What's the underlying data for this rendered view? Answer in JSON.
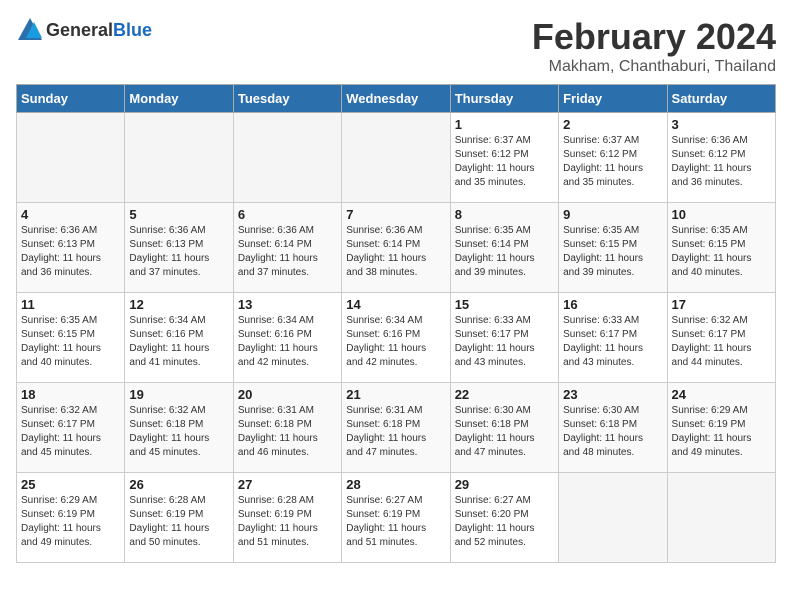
{
  "header": {
    "logo_general": "General",
    "logo_blue": "Blue",
    "title": "February 2024",
    "subtitle": "Makham, Chanthaburi, Thailand"
  },
  "days_of_week": [
    "Sunday",
    "Monday",
    "Tuesday",
    "Wednesday",
    "Thursday",
    "Friday",
    "Saturday"
  ],
  "weeks": [
    [
      {
        "day": "",
        "info": ""
      },
      {
        "day": "",
        "info": ""
      },
      {
        "day": "",
        "info": ""
      },
      {
        "day": "",
        "info": ""
      },
      {
        "day": "1",
        "info": "Sunrise: 6:37 AM\nSunset: 6:12 PM\nDaylight: 11 hours\nand 35 minutes."
      },
      {
        "day": "2",
        "info": "Sunrise: 6:37 AM\nSunset: 6:12 PM\nDaylight: 11 hours\nand 35 minutes."
      },
      {
        "day": "3",
        "info": "Sunrise: 6:36 AM\nSunset: 6:12 PM\nDaylight: 11 hours\nand 36 minutes."
      }
    ],
    [
      {
        "day": "4",
        "info": "Sunrise: 6:36 AM\nSunset: 6:13 PM\nDaylight: 11 hours\nand 36 minutes."
      },
      {
        "day": "5",
        "info": "Sunrise: 6:36 AM\nSunset: 6:13 PM\nDaylight: 11 hours\nand 37 minutes."
      },
      {
        "day": "6",
        "info": "Sunrise: 6:36 AM\nSunset: 6:14 PM\nDaylight: 11 hours\nand 37 minutes."
      },
      {
        "day": "7",
        "info": "Sunrise: 6:36 AM\nSunset: 6:14 PM\nDaylight: 11 hours\nand 38 minutes."
      },
      {
        "day": "8",
        "info": "Sunrise: 6:35 AM\nSunset: 6:14 PM\nDaylight: 11 hours\nand 39 minutes."
      },
      {
        "day": "9",
        "info": "Sunrise: 6:35 AM\nSunset: 6:15 PM\nDaylight: 11 hours\nand 39 minutes."
      },
      {
        "day": "10",
        "info": "Sunrise: 6:35 AM\nSunset: 6:15 PM\nDaylight: 11 hours\nand 40 minutes."
      }
    ],
    [
      {
        "day": "11",
        "info": "Sunrise: 6:35 AM\nSunset: 6:15 PM\nDaylight: 11 hours\nand 40 minutes."
      },
      {
        "day": "12",
        "info": "Sunrise: 6:34 AM\nSunset: 6:16 PM\nDaylight: 11 hours\nand 41 minutes."
      },
      {
        "day": "13",
        "info": "Sunrise: 6:34 AM\nSunset: 6:16 PM\nDaylight: 11 hours\nand 42 minutes."
      },
      {
        "day": "14",
        "info": "Sunrise: 6:34 AM\nSunset: 6:16 PM\nDaylight: 11 hours\nand 42 minutes."
      },
      {
        "day": "15",
        "info": "Sunrise: 6:33 AM\nSunset: 6:17 PM\nDaylight: 11 hours\nand 43 minutes."
      },
      {
        "day": "16",
        "info": "Sunrise: 6:33 AM\nSunset: 6:17 PM\nDaylight: 11 hours\nand 43 minutes."
      },
      {
        "day": "17",
        "info": "Sunrise: 6:32 AM\nSunset: 6:17 PM\nDaylight: 11 hours\nand 44 minutes."
      }
    ],
    [
      {
        "day": "18",
        "info": "Sunrise: 6:32 AM\nSunset: 6:17 PM\nDaylight: 11 hours\nand 45 minutes."
      },
      {
        "day": "19",
        "info": "Sunrise: 6:32 AM\nSunset: 6:18 PM\nDaylight: 11 hours\nand 45 minutes."
      },
      {
        "day": "20",
        "info": "Sunrise: 6:31 AM\nSunset: 6:18 PM\nDaylight: 11 hours\nand 46 minutes."
      },
      {
        "day": "21",
        "info": "Sunrise: 6:31 AM\nSunset: 6:18 PM\nDaylight: 11 hours\nand 47 minutes."
      },
      {
        "day": "22",
        "info": "Sunrise: 6:30 AM\nSunset: 6:18 PM\nDaylight: 11 hours\nand 47 minutes."
      },
      {
        "day": "23",
        "info": "Sunrise: 6:30 AM\nSunset: 6:18 PM\nDaylight: 11 hours\nand 48 minutes."
      },
      {
        "day": "24",
        "info": "Sunrise: 6:29 AM\nSunset: 6:19 PM\nDaylight: 11 hours\nand 49 minutes."
      }
    ],
    [
      {
        "day": "25",
        "info": "Sunrise: 6:29 AM\nSunset: 6:19 PM\nDaylight: 11 hours\nand 49 minutes."
      },
      {
        "day": "26",
        "info": "Sunrise: 6:28 AM\nSunset: 6:19 PM\nDaylight: 11 hours\nand 50 minutes."
      },
      {
        "day": "27",
        "info": "Sunrise: 6:28 AM\nSunset: 6:19 PM\nDaylight: 11 hours\nand 51 minutes."
      },
      {
        "day": "28",
        "info": "Sunrise: 6:27 AM\nSunset: 6:19 PM\nDaylight: 11 hours\nand 51 minutes."
      },
      {
        "day": "29",
        "info": "Sunrise: 6:27 AM\nSunset: 6:20 PM\nDaylight: 11 hours\nand 52 minutes."
      },
      {
        "day": "",
        "info": ""
      },
      {
        "day": "",
        "info": ""
      }
    ]
  ]
}
